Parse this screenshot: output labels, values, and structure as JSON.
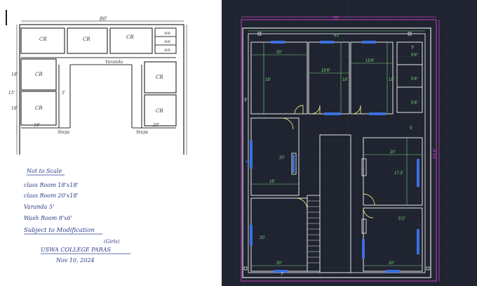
{
  "left_sketch": {
    "plan_labels": {
      "top_width": "80'",
      "cr1": "CR",
      "cr2": "CR",
      "cr3": "CR",
      "wr": "WR",
      "varanda": "Varanda",
      "left_cr1": "CR",
      "left_cr2": "CR",
      "right_cr1": "CR",
      "right_cr2": "CR",
      "dim_18a": "18'",
      "dim_18b": "18'",
      "dim_18c": "18'",
      "dim_20": "20'",
      "dim_15": "15'",
      "dim_5": "5'",
      "steps_left": "Steps",
      "steps_right": "Steps"
    },
    "notes": [
      "Not to Scale",
      "class Room 18'x18'",
      "class Room 20'x18'",
      "Varanda 5'",
      "Wash Room 8'x6'",
      "Subject to Modification",
      "(Girls)",
      "USWA COLLEGE PARAS",
      "Nov 10, 2024"
    ]
  },
  "cad_plan": {
    "labels": {
      "overall_width": "76'",
      "inner_width": "63'",
      "overall_height": "63.6'",
      "left_height": "63'",
      "room_tl_w": "20'",
      "room_tm_w": "15'6\"",
      "room_tr_w": "15'6\"",
      "room_tl_h": "18'",
      "room_tm_h": "18'",
      "room_tr_h": "18'",
      "wr1": "5'6\"",
      "wr2": "5'6\"",
      "wr3": "5'6\"",
      "room_ml_w": "20'",
      "room_ml_h": "15'",
      "room_bl_w": "20'",
      "room_bl_h": "20'",
      "room_mr_w": "20'",
      "room_mr_h": "17.3'",
      "room_br_w": "20'",
      "room_br_h": "5'2\"",
      "dim_5": "5'",
      "dim_3": "3'",
      "dim_7a": "7'",
      "dim_7b": "7'"
    },
    "colors": {
      "background": "#1f2430",
      "wall": "#e6e6e6",
      "dimension": "#7cd67c",
      "door": "#e8e87a",
      "window": "#3a6fe0",
      "outline": "#c040c0"
    }
  }
}
